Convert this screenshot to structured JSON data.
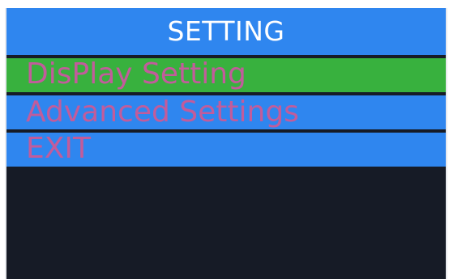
{
  "header": {
    "title": "SETTING"
  },
  "menu": {
    "items": [
      {
        "label": "DisPlay Setting",
        "selected": true
      },
      {
        "label": "Advanced Settings",
        "selected": false
      },
      {
        "label": "EXIT",
        "selected": false
      }
    ]
  },
  "colors": {
    "header_bg": "#2f86ef",
    "selected_bg": "#38b13e",
    "item_bg": "#2f86ef",
    "item_text": "#c25c9b",
    "title_text": "#ffffff",
    "screen_bg": "#161b26"
  }
}
